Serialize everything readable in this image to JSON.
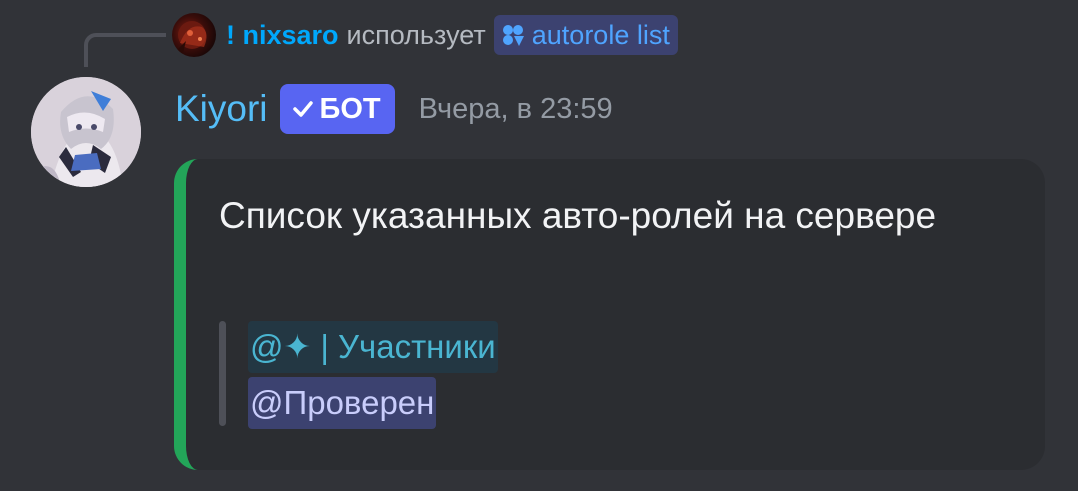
{
  "reply": {
    "username": "! nixsaro",
    "verb": "использует",
    "command": "autorole list",
    "command_icon": "slash-command-icon"
  },
  "message": {
    "author": "Kiyori",
    "badge": "БОТ",
    "badge_icon": "checkmark-icon",
    "timestamp": "Вчера, в 23:59"
  },
  "embed": {
    "accent_color": "#23a559",
    "title": "Список указанных авто-ролей на сервере",
    "roles": [
      {
        "label": "@✦ | Участники",
        "color": "#4ab5d1"
      },
      {
        "label": "@Проверен",
        "color": "#c9cdfb"
      }
    ]
  },
  "colors": {
    "background": "#313338",
    "embed_background": "#2b2d31",
    "username": "#55bdf7",
    "reply_name": "#00a8fc",
    "bot_badge": "#5865f2"
  }
}
